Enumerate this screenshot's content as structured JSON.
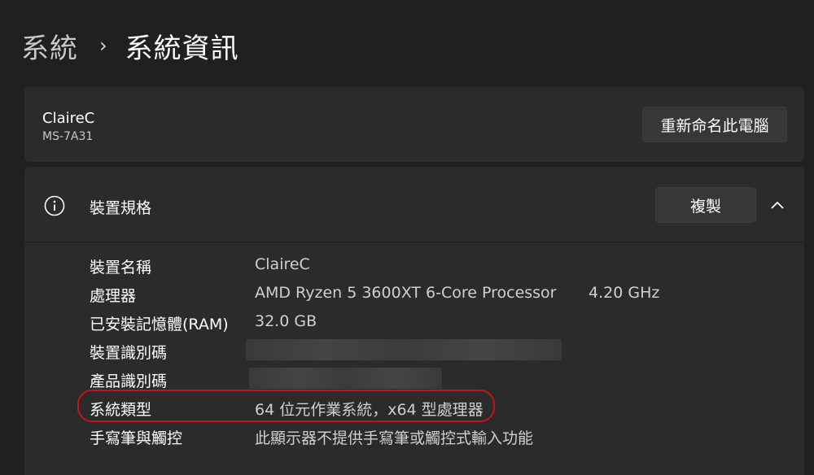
{
  "breadcrumb": {
    "parent": "系統",
    "separator": "›",
    "current": "系統資訊"
  },
  "device_card": {
    "name": "ClaireC",
    "model": "MS-7A31",
    "rename_button": "重新命名此電腦"
  },
  "spec_section": {
    "title": "裝置規格",
    "copy_button": "複製",
    "rows": [
      {
        "label": "裝置名稱",
        "value": "ClaireC"
      },
      {
        "label": "處理器",
        "value": "AMD Ryzen 5 3600XT 6-Core Processor",
        "extra": "4.20 GHz"
      },
      {
        "label": "已安裝記憶體(RAM)",
        "value": "32.0 GB"
      },
      {
        "label": "裝置識別碼",
        "value": ""
      },
      {
        "label": "產品識別碼",
        "value": ""
      },
      {
        "label": "系統類型",
        "value": "64 位元作業系統，x64 型處理器"
      },
      {
        "label": "手寫筆與觸控",
        "value": "此顯示器不提供手寫筆或觸控式輸入功能"
      }
    ]
  },
  "colors": {
    "background": "#202020",
    "card": "#2b2b2b",
    "highlight": "#c0151f"
  }
}
